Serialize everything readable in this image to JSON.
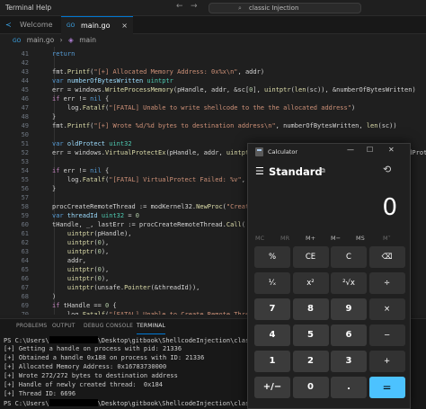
{
  "titlebar": {
    "menu": [
      "Terminal",
      "Help"
    ],
    "search_text": "classic Injection"
  },
  "tabs": [
    {
      "label": "Welcome",
      "icon": "vscode-icon"
    },
    {
      "label": "main.go",
      "icon": "go-file-icon"
    }
  ],
  "breadcrumb": [
    "main.go",
    "main"
  ],
  "editor": {
    "line_numbers": [
      "41",
      "42",
      "43",
      "44",
      "45",
      "46",
      "47",
      "48",
      "49",
      "50",
      "51",
      "52",
      "53",
      "54",
      "55",
      "56",
      "57",
      "58",
      "59",
      "60",
      "61",
      "62",
      "63",
      "64",
      "65",
      "66",
      "67",
      "68",
      "69",
      "70"
    ]
  },
  "panel": {
    "tabs": [
      "PROBLEMS",
      "OUTPUT",
      "DEBUG CONSOLE",
      "TERMINAL"
    ],
    "active_tab": "TERMINAL",
    "terminal_lines": [
      {
        "pre": "PS C:\\Users\\",
        "post": "\\Desktop\\gitbook\\ShellcodeInjection\\classic In"
      },
      {
        "pre": "[+] Getting a handle on process with pid: 21336",
        "post": ""
      },
      {
        "pre": "[+] Obtained a handle 0x188 on process with ID: 21336",
        "post": ""
      },
      {
        "pre": "[+] Allocated Memory Address: 0x16783730000",
        "post": ""
      },
      {
        "pre": "[+] Wrote 272/272 bytes to destination address",
        "post": ""
      },
      {
        "pre": "[+] Handle of newly created thread:  0x184",
        "post": ""
      },
      {
        "pre": "[+] Thread ID: 6696",
        "post": ""
      },
      {
        "pre": "PS C:\\Users\\",
        "post": "\\Desktop\\gitbook\\ShellcodeInjection\\classic In"
      }
    ]
  },
  "calculator": {
    "title": "Calculator",
    "mode": "Standard",
    "display": "0",
    "memory": [
      "MC",
      "MR",
      "M+",
      "M−",
      "MS",
      "M˅"
    ],
    "keys": [
      [
        "%",
        "CE",
        "C",
        "⌫"
      ],
      [
        "¹⁄ₓ",
        "x²",
        "²√x",
        "÷"
      ],
      [
        "7",
        "8",
        "9",
        "×"
      ],
      [
        "4",
        "5",
        "6",
        "−"
      ],
      [
        "1",
        "2",
        "3",
        "+"
      ],
      [
        "+/−",
        "0",
        ".",
        "="
      ]
    ],
    "accent_color": "#4cc2ff"
  }
}
